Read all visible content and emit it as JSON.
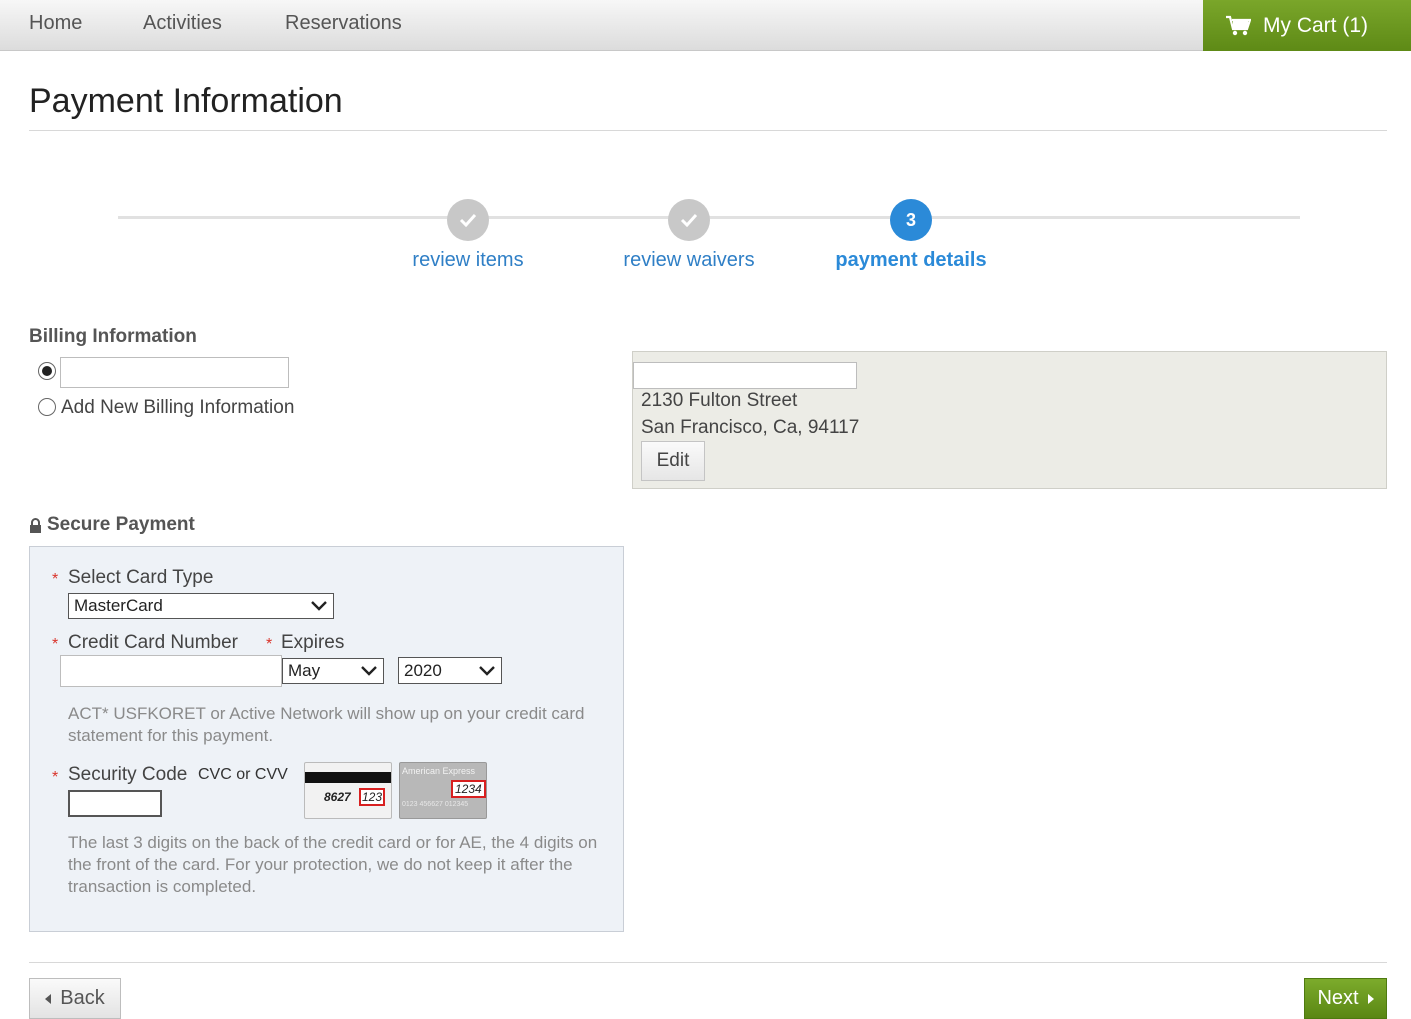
{
  "nav": {
    "items": [
      {
        "label": "Home"
      },
      {
        "label": "Activities"
      },
      {
        "label": "Reservations"
      }
    ],
    "cart_label": "My Cart (1)"
  },
  "page": {
    "title": "Payment Information"
  },
  "steps": [
    {
      "label": "review items",
      "state": "done",
      "number": ""
    },
    {
      "label": "review waivers",
      "state": "done",
      "number": ""
    },
    {
      "label": "payment details",
      "state": "active",
      "number": "3"
    }
  ],
  "billing": {
    "heading": "Billing Information",
    "existing_value": "",
    "add_new_label": "Add New Billing Information",
    "address_name": "",
    "address_line1": "2130 Fulton Street",
    "address_line2": "San Francisco, Ca, 94117",
    "edit_label": "Edit"
  },
  "payment": {
    "heading": "Secure Payment",
    "card_type_label": "Select Card Type",
    "card_type_value": "MasterCard",
    "card_number_label": "Credit Card Number",
    "expires_label": "Expires",
    "exp_month": "May",
    "exp_year": "2020",
    "statement_note": "ACT* USFKORET or Active Network will show up on your credit card statement for this payment.",
    "security_label": "Security Code",
    "security_sub": "CVC or CVV",
    "card_back_digits": "8627",
    "card_back_cvv": "123",
    "amex_brand": "American Express",
    "amex_cvv": "1234",
    "amex_number": "0123 456627 012345",
    "security_note": "The last 3 digits on the back of the credit card or for AE, the 4 digits on the front of the card. For your protection, we do not keep it after the transaction is completed."
  },
  "footer": {
    "back_label": "Back",
    "next_label": "Next"
  },
  "colors": {
    "accent_green": "#6b9a1f",
    "step_active": "#2b8ad8",
    "link_blue": "#2f7fc6",
    "required_red": "#d9342b"
  }
}
